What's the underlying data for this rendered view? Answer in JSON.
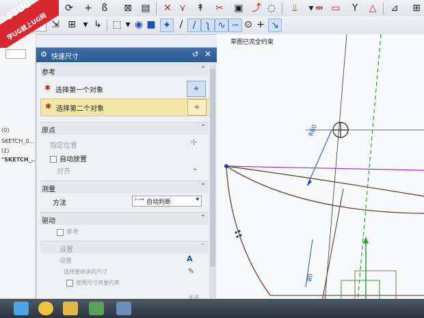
{
  "watermark": {
    "line1": "9SUG",
    "line2": "学UG就上UG网"
  },
  "toolbar_top": {
    "icons": [
      "fillet-icon",
      "line-icon",
      "arc-icon",
      "circle-icon",
      "plus-icon",
      "polygon-icon",
      "offset-curve-icon",
      "mirror-icon",
      "trim-icon",
      "extend-icon",
      "corner-icon",
      "make-corner-icon",
      "quick-trim-icon",
      "quick-extend-icon",
      "constraint-icon",
      "geometric-constraint-icon",
      "dimension-icon",
      "angular-dimension-icon"
    ]
  },
  "toolbar_second": {
    "icons": [
      "selection-filter-icon",
      "snap-icon",
      "box-select-icon",
      "view-cube-icon",
      "shaded-icon",
      "point-on-curve-icon",
      "end-point-icon",
      "mid-point-icon",
      "control-point-icon",
      "intersection-icon",
      "arc-center-icon",
      "existing-point-icon",
      "point-on-line-icon"
    ]
  },
  "navigator": {
    "items": [
      "(0)",
      "SKETCH_0...",
      "(2)",
      "\"SKETCH_..."
    ]
  },
  "dialog": {
    "title": "快速尺寸",
    "sections": {
      "reference": {
        "title": "参考",
        "first": "选择第一个对象",
        "second": "选择第二个对象"
      },
      "origin": {
        "title": "原点",
        "specify": "指定位置",
        "auto_place": "自动放置",
        "align": "对齐"
      },
      "measure": {
        "title": "测量",
        "method_label": "方法",
        "method_value": "自动判断"
      },
      "driving": {
        "title": "驱动",
        "reference": "参考"
      },
      "settings": {
        "title": "设置",
        "settings_label": "设置",
        "select_dim": "选择要继承的尺寸",
        "use_dim": "使用尺寸将要约束"
      }
    },
    "close_label": "关闭"
  },
  "canvas": {
    "status": "草图已完全约束",
    "dim_r60": "R60",
    "dim_80": "80"
  },
  "colors": {
    "title_bar": "#2c5a92",
    "highlight_row": "#f2e6a8",
    "accent_blue": "#1d4e9a",
    "sketch_curve": "#6b4b3e",
    "magenta_line": "#a326c9",
    "green_axis": "#2d9e3a"
  }
}
